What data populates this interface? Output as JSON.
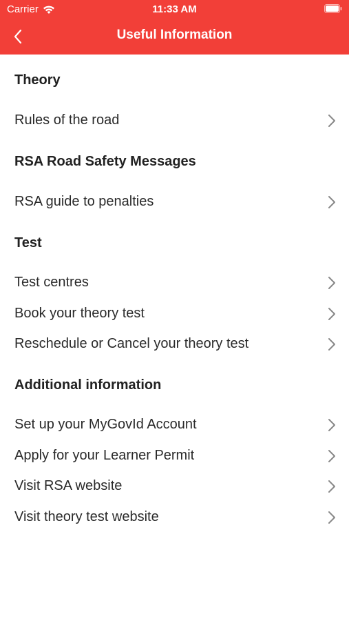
{
  "status_bar": {
    "carrier": "Carrier",
    "time": "11:33 AM"
  },
  "nav": {
    "title": "Useful Information",
    "back_icon": "chevron-left-icon"
  },
  "colors": {
    "header": "#f23f38",
    "text": "#222222",
    "chevron": "#888888"
  },
  "sections": [
    {
      "title": "Theory",
      "items": [
        {
          "label": "Rules of the road"
        }
      ]
    },
    {
      "title": "RSA Road Safety Messages",
      "items": [
        {
          "label": "RSA guide to penalties"
        }
      ]
    },
    {
      "title": "Test",
      "items": [
        {
          "label": "Test centres"
        },
        {
          "label": "Book your theory test"
        },
        {
          "label": "Reschedule or Cancel your theory test"
        }
      ]
    },
    {
      "title": "Additional information",
      "items": [
        {
          "label": "Set up your MyGovId Account"
        },
        {
          "label": "Apply for your Learner Permit"
        },
        {
          "label": "Visit RSA website"
        },
        {
          "label": "Visit theory test website"
        }
      ]
    }
  ]
}
